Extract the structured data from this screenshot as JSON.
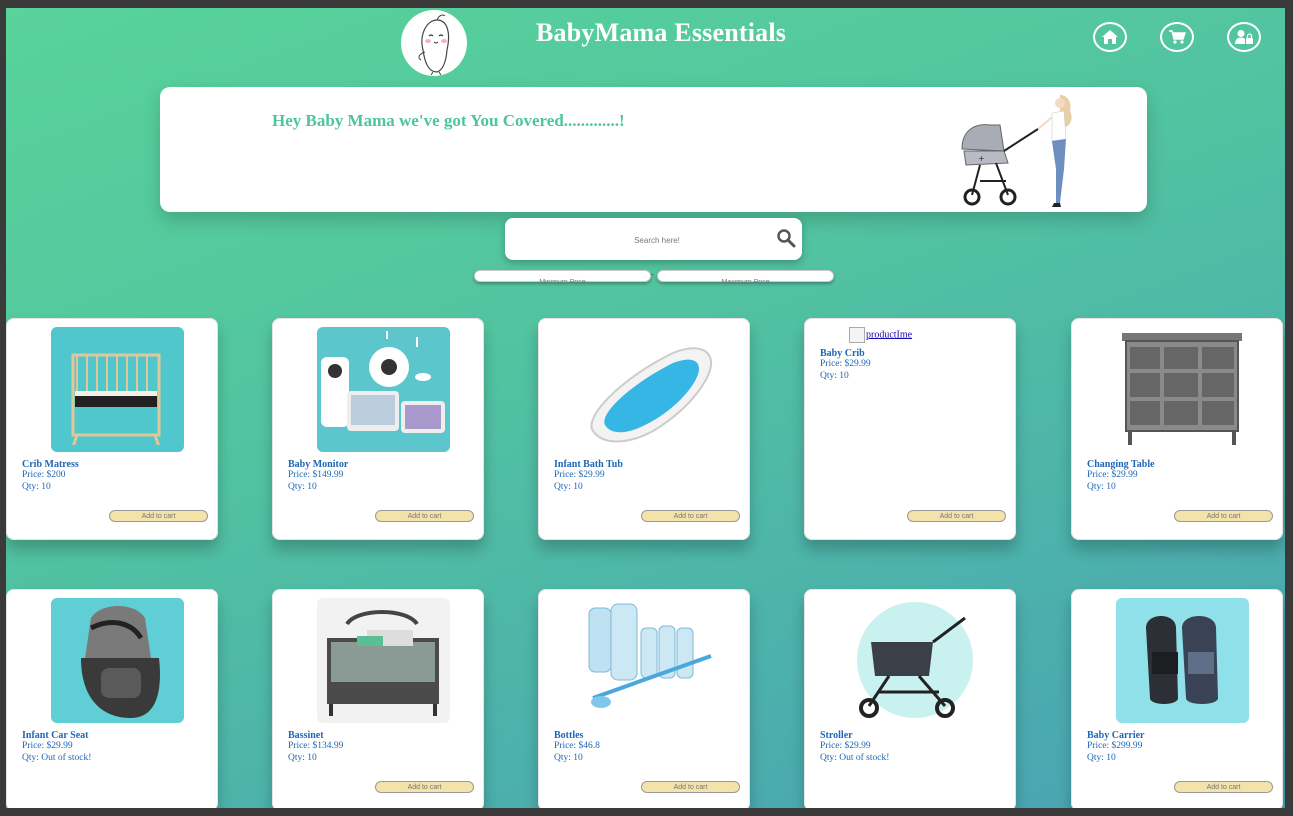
{
  "header": {
    "title": "BabyMama Essentials",
    "icons": [
      "home-icon",
      "cart-icon",
      "user-lock-icon"
    ]
  },
  "banner": {
    "text": "Hey Baby Mama we've got You Covered.............!"
  },
  "search": {
    "placeholder": "Search here!",
    "min_price_placeholder": "Minimum Price",
    "max_price_placeholder": "Maximum Price",
    "separator": "-"
  },
  "products": [
    {
      "name": "Crib Matress",
      "price": "Price: $200",
      "qty": "Qty: 10",
      "button": "Add to cart"
    },
    {
      "name": "Baby Monitor",
      "price": "Price: $149.99",
      "qty": "Qty: 10",
      "button": "Add to cart"
    },
    {
      "name": "Infant Bath Tub",
      "price": "Price: $29.99",
      "qty": "Qty: 10",
      "button": "Add to cart"
    },
    {
      "name": "Baby Crib",
      "price": "Price: $29.99",
      "qty": "Qty: 10",
      "button": "Add to cart",
      "broken_image_alt": "productIme"
    },
    {
      "name": "Changing Table",
      "price": "Price: $29.99",
      "qty": "Qty: 10",
      "button": "Add to cart"
    },
    {
      "name": "Infant Car Seat",
      "price": "Price: $29.99",
      "qty": "Qty: Out of stock!",
      "button": ""
    },
    {
      "name": "Bassinet",
      "price": "Price: $134.99",
      "qty": "Qty: 10",
      "button": "Add to cart"
    },
    {
      "name": "Bottles",
      "price": "Price: $46.8",
      "qty": "Qty: 10",
      "button": "Add to cart"
    },
    {
      "name": "Stroller",
      "price": "Price: $29.99",
      "qty": "Qty: Out of stock!",
      "button": ""
    },
    {
      "name": "Baby Carrier",
      "price": "Price: $299.99",
      "qty": "Qty: 10",
      "button": "Add to cart"
    }
  ],
  "colors": {
    "gradient_start": "#58d39a",
    "gradient_end": "#4aa2b4",
    "accent_text": "#4ec59b",
    "product_text": "#1e66b6",
    "button_bg": "#f3e2a9"
  }
}
